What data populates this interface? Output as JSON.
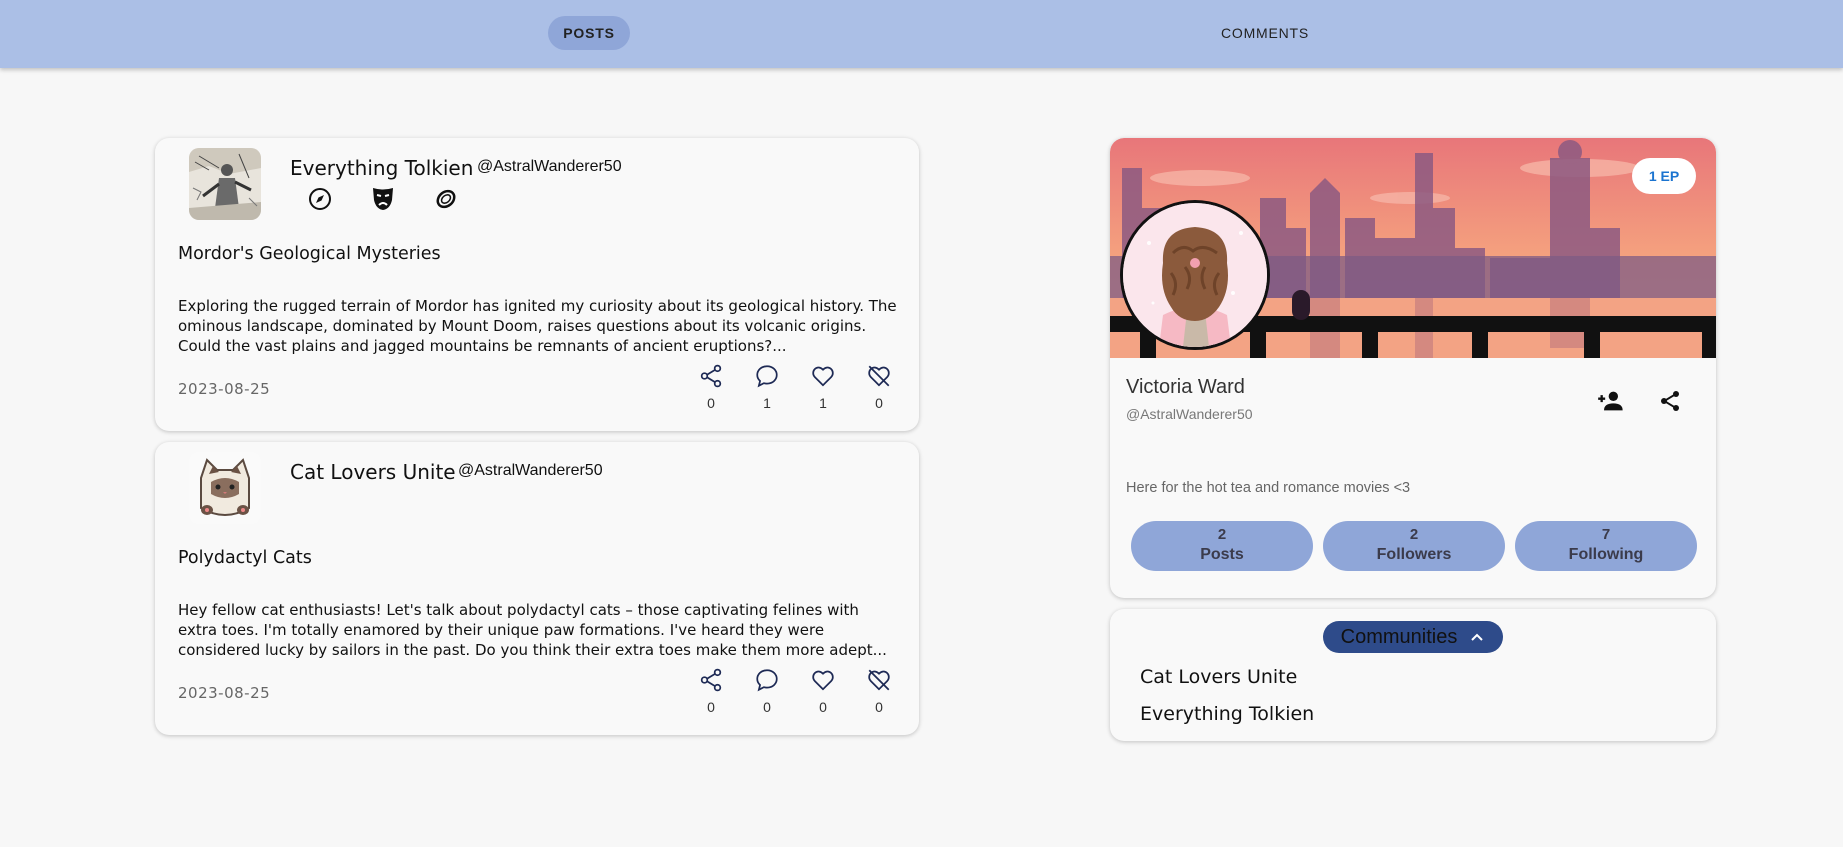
{
  "tabs": {
    "posts": "POSTS",
    "comments": "COMMENTS",
    "active": "posts"
  },
  "posts": [
    {
      "community": "Everything Tolkien",
      "handle": "@AstralWanderer50",
      "badges": [
        "compass-icon",
        "theater-mask-icon",
        "ring-icon"
      ],
      "title": "Mordor's Geological Mysteries",
      "body": "Exploring the rugged terrain of Mordor has ignited my curiosity about its geological history. The ominous landscape, dominated by Mount Doom, raises questions about its volcanic origins. Could the vast plains and jagged mountains be remnants of ancient eruptions?...",
      "date": "2023-08-25",
      "counts": {
        "shares": "0",
        "comments": "1",
        "likes": "1",
        "dislikes": "0"
      }
    },
    {
      "community": "Cat Lovers Unite",
      "handle": "@AstralWanderer50",
      "badges": [],
      "title": "Polydactyl Cats",
      "body": "Hey fellow cat enthusiasts! Let's talk about polydactyl cats – those captivating felines with extra toes. I'm totally enamored by their unique paw formations. I've heard they were considered lucky by sailors in the past. Do you think their extra toes make them more adept...",
      "date": "2023-08-25",
      "counts": {
        "shares": "0",
        "comments": "0",
        "likes": "0",
        "dislikes": "0"
      }
    }
  ],
  "profile": {
    "ep_badge": "1 EP",
    "name": "Victoria Ward",
    "handle": "@AstralWanderer50",
    "bio": "Here for the hot tea and romance movies <3",
    "stats": [
      {
        "value": "2",
        "label": "Posts"
      },
      {
        "value": "2",
        "label": "Followers"
      },
      {
        "value": "7",
        "label": "Following"
      }
    ]
  },
  "communities": {
    "label": "Communities",
    "expanded": true,
    "items": [
      "Cat Lovers Unite",
      "Everything Tolkien"
    ]
  },
  "colors": {
    "header": "#abbfe6",
    "active_tab": "#8fa6d8",
    "stat_pill": "#8fa6d8",
    "communities_pill": "#2e4b8a",
    "ep_text": "#1b74d0"
  }
}
